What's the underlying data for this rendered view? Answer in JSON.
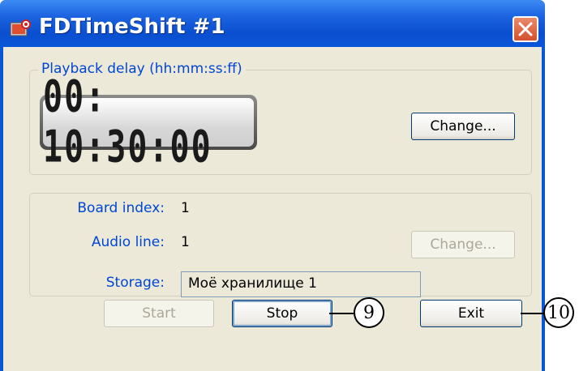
{
  "window": {
    "title": "FDTimeShift #1",
    "accent": "#0a57d6",
    "background": "#ece9d8"
  },
  "playback": {
    "group_title": "Playback delay (hh:mm:ss:ff)",
    "delay_value": "00: 10:30:00",
    "change_label": "Change..."
  },
  "board": {
    "board_index_label": "Board index:",
    "board_index_value": "1",
    "audio_line_label": "Audio line:",
    "audio_line_value": "1",
    "storage_label": "Storage:",
    "storage_value": "Моё хранилище 1",
    "change_label": "Change..."
  },
  "actions": {
    "start_label": "Start",
    "stop_label": "Stop",
    "exit_label": "Exit"
  },
  "callouts": {
    "stop_number": "9",
    "exit_number": "10"
  }
}
